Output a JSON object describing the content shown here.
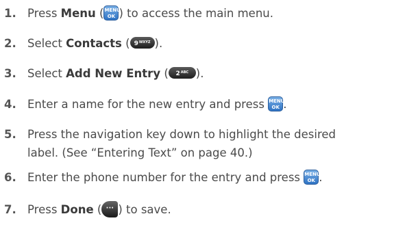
{
  "steps": [
    {
      "num": "1.",
      "pre": "Press ",
      "bold": "Menu",
      "mid": " (",
      "post": ") to access the main menu."
    },
    {
      "num": "2.",
      "pre": "Select ",
      "bold": "Contacts",
      "mid": " (",
      "post": ")."
    },
    {
      "num": "3.",
      "pre": "Select ",
      "bold": "Add New Entry",
      "mid": " (",
      "post": ")."
    },
    {
      "num": "4.",
      "text": "Enter a name for the new entry and press "
    },
    {
      "num": "5.",
      "line1": "Press the navigation key down to highlight the desired",
      "line2": "label. (See “Entering Text” on page 40.)"
    },
    {
      "num": "6.",
      "text": "Enter the phone number for the entry and press "
    },
    {
      "num": "7.",
      "pre": "Press ",
      "bold": "Done",
      "mid": " (",
      "post": ") to save."
    }
  ],
  "keys": {
    "menu_top": "MENU",
    "menu_bottom": "OK",
    "key9_digit": "9",
    "key9_letters": "WXYZ",
    "key2_digit": "2",
    "key2_letters": "ABC",
    "done_key": "···"
  },
  "icons": {
    "menu_ok_key": "menu-ok-key-icon",
    "key_9": "key-9-icon",
    "key_2": "key-2-icon",
    "soft_key": "softkey-icon"
  },
  "colors": {
    "menu_key_blue": "#2f73c4",
    "text": "#4a4a4a"
  }
}
